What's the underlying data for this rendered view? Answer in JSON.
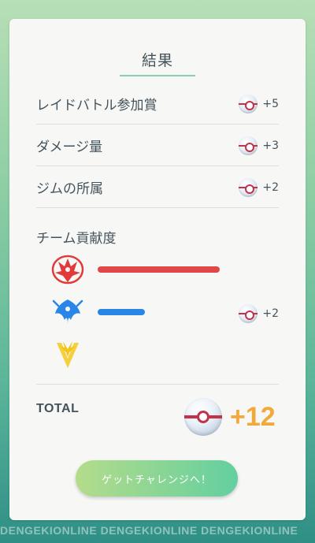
{
  "result": {
    "title": "結果",
    "rows": [
      {
        "label": "レイドバトル参加賞",
        "reward": "+5"
      },
      {
        "label": "ダメージ量",
        "reward": "+3"
      },
      {
        "label": "ジムの所属",
        "reward": "+2"
      }
    ],
    "team_section_label": "チーム貢献度",
    "teams": [
      {
        "name": "valor",
        "contribution": 0.62,
        "color": "#e04848",
        "reward": ""
      },
      {
        "name": "mystic",
        "contribution": 0.24,
        "color": "#2a86e6",
        "reward": "+2"
      },
      {
        "name": "instinct",
        "contribution": 0.0,
        "color": "#f2c51c",
        "reward": ""
      }
    ],
    "total_label": "TOTAL",
    "total_value": "+12",
    "button_label": "ゲットチャレンジへ！"
  },
  "icons": {
    "ball": "premier-ball-icon",
    "team_valor": "moltres-valor-icon",
    "team_mystic": "articuno-mystic-icon",
    "team_instinct": "zapdos-instinct-icon"
  },
  "watermark": "DENGEKIONLINE"
}
